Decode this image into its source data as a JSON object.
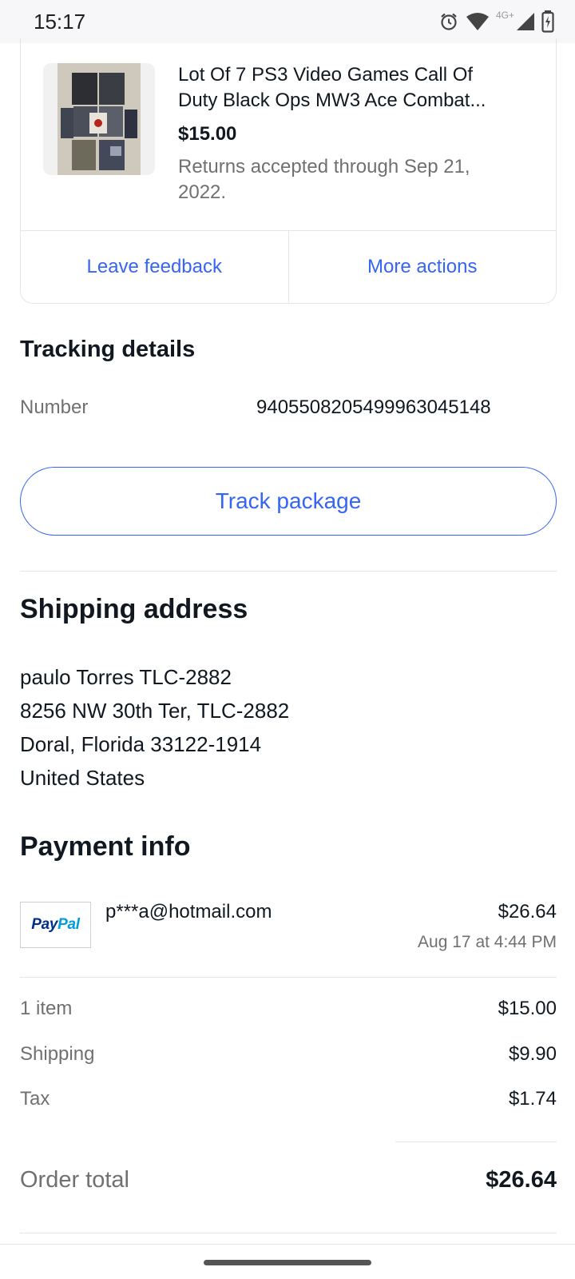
{
  "status_bar": {
    "time": "15:17",
    "network": "4G+"
  },
  "order_item": {
    "title": "Lot Of 7 PS3 Video Games Call Of Duty Black Ops MW3 Ace Combat...",
    "title_line1": "Lot Of 7 PS3 Video Games Call Of",
    "title_line2": "Duty Black Ops MW3 Ace Combat...",
    "price": "$15.00",
    "returns_line1": "Returns accepted through Sep 21,",
    "returns_line2": "2022.",
    "actions": {
      "leave_feedback": "Leave feedback",
      "more_actions": "More actions"
    }
  },
  "tracking": {
    "title": "Tracking details",
    "number_label": "Number",
    "number_value": "9405508205499963045148",
    "track_button": "Track package"
  },
  "shipping": {
    "title": "Shipping address",
    "lines": [
      "paulo Torres TLC-2882",
      "8256 NW 30th Ter, TLC-2882",
      "Doral, Florida 33122-1914",
      "United States"
    ]
  },
  "payment": {
    "title": "Payment info",
    "method_logo": {
      "pay": "Pay",
      "pal": "Pal"
    },
    "email": "p***a@hotmail.com",
    "amount": "$26.64",
    "date": "Aug 17 at 4:44 PM"
  },
  "summary": {
    "rows": [
      {
        "label": "1 item",
        "value": "$15.00"
      },
      {
        "label": "Shipping",
        "value": "$9.90"
      },
      {
        "label": "Tax",
        "value": "$1.74"
      }
    ],
    "total_label": "Order total",
    "total_value": "$26.64"
  },
  "colors": {
    "link": "#3665f3",
    "text": "#111820",
    "muted": "#707070",
    "paypal_dark": "#003087",
    "paypal_light": "#009cde"
  }
}
